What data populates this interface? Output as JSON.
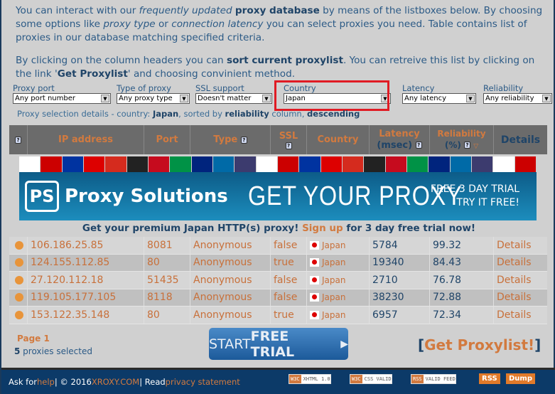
{
  "intro": {
    "p1_a": "You can interact with our ",
    "p1_b": "frequently updated",
    "p1_c": " ",
    "p1_d": "proxy database",
    "p1_e": " by means of the listboxes below. By choosing some options like ",
    "p1_f": "proxy type",
    "p1_g": " or ",
    "p1_h": "connection latency",
    "p1_i": " you can select proxies you need. Table contains list of proxies in our database matching specified criteria.",
    "p2_a": "By clicking on the column headers you can ",
    "p2_b": "sort current proxylist",
    "p2_c": ". You can retreive this list by clicking on the link '",
    "p2_d": "Get Proxylist",
    "p2_e": "' and choosing convinient method."
  },
  "filters": [
    {
      "label": "Proxy port",
      "value": "Any port number"
    },
    {
      "label": "Type of proxy",
      "value": "Any proxy type"
    },
    {
      "label": "SSL support",
      "value": "Doesn't matter"
    },
    {
      "label": "Country",
      "value": "Japan"
    },
    {
      "label": "Latency",
      "value": "Any latency"
    },
    {
      "label": "Reliability",
      "value": "Any reliability"
    }
  ],
  "details": {
    "a": "Proxy selection details - country: ",
    "country": "Japan",
    "b": ", sorted by ",
    "col": "reliability",
    "c": " column, ",
    "order": "descending"
  },
  "table": {
    "headers": {
      "help": "?",
      "ip": "IP address",
      "port": "Port",
      "type": "Type",
      "ssl": "SSL",
      "country": "Country",
      "latency": "Latency",
      "latency_unit": "(msec)",
      "reliability": "Reliability",
      "reliability_unit": "(%)",
      "details": "Details"
    },
    "rows": [
      {
        "ip": "106.186.25.85",
        "port": "8081",
        "type": "Anonymous",
        "ssl": "false",
        "country": "Japan",
        "latency": "5784",
        "reliability": "99.32",
        "details": "Details"
      },
      {
        "ip": "124.155.112.85",
        "port": "80",
        "type": "Anonymous",
        "ssl": "true",
        "country": "Japan",
        "latency": "19340",
        "reliability": "84.43",
        "details": "Details"
      },
      {
        "ip": "27.120.112.18",
        "port": "51435",
        "type": "Anonymous",
        "ssl": "false",
        "country": "Japan",
        "latency": "2710",
        "reliability": "76.78",
        "details": "Details"
      },
      {
        "ip": "119.105.177.105",
        "port": "8118",
        "type": "Anonymous",
        "ssl": "false",
        "country": "Japan",
        "latency": "38230",
        "reliability": "72.88",
        "details": "Details"
      },
      {
        "ip": "153.122.35.148",
        "port": "80",
        "type": "Anonymous",
        "ssl": "true",
        "country": "Japan",
        "latency": "6957",
        "reliability": "72.34",
        "details": "Details"
      }
    ]
  },
  "banner": {
    "logo": "PS",
    "brand": "Proxy Solutions",
    "headline": "GET YOUR PROXY",
    "trial1": "FREE 3 DAY TRIAL",
    "trial2": "TRY IT FREE!"
  },
  "promo": {
    "a": "Get your premium Japan HTTP(s) proxy! ",
    "link": "Sign up",
    "b": " for 3 day free trial now!"
  },
  "pager": {
    "page": "Page 1",
    "count": "5",
    "count_text": " proxies selected"
  },
  "trial_button": {
    "a": "START ",
    "b": "FREE TRIAL",
    "arrow": "▶"
  },
  "get_proxylist": {
    "open": "[",
    "label": "Get Proxylist!",
    "close": "]"
  },
  "footer": {
    "a": "Ask for ",
    "help": "help",
    "b": " | © 2016 ",
    "site": "XROXY.COM",
    "c": " | Read ",
    "privacy": "privacy statement",
    "badges": [
      {
        "tag": "W3C",
        "text": "XHTML 1.0"
      },
      {
        "tag": "W3C",
        "text": "CSS VALID"
      },
      {
        "tag": "RSS",
        "text": "VALID FEED"
      }
    ],
    "rss": "RSS",
    "dump": "Dump"
  },
  "colors": {
    "accent": "#d27a3f",
    "text": "#2b5a86",
    "highlight": "#e01b24",
    "footer": "#0c3a68"
  }
}
